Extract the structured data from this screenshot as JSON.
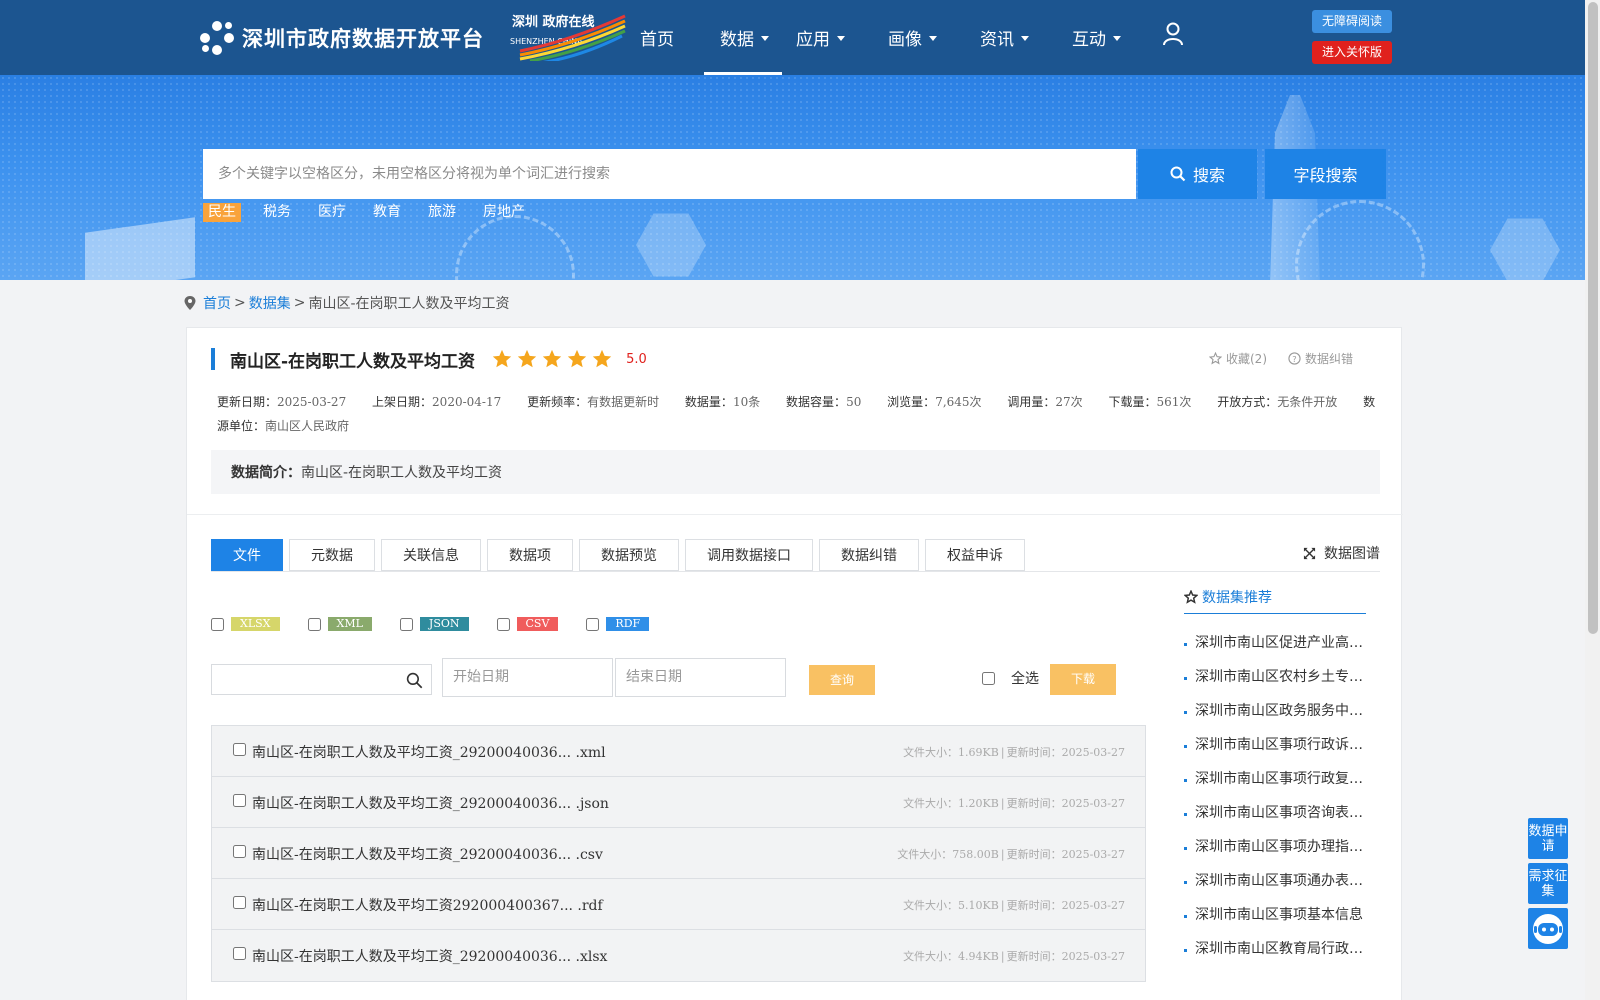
{
  "header": {
    "site_name": "深圳市政府数据开放平台",
    "city_logo_text": "深圳 政府在线",
    "city_logo_sub": "SHENZHEN CHINA",
    "nav": [
      {
        "label": "首页",
        "dropdown": false,
        "active": false
      },
      {
        "label": "数据",
        "dropdown": true,
        "active": true
      },
      {
        "label": "应用",
        "dropdown": true,
        "active": false
      },
      {
        "label": "画像",
        "dropdown": true,
        "active": false
      },
      {
        "label": "资讯",
        "dropdown": true,
        "active": false
      },
      {
        "label": "互动",
        "dropdown": true,
        "active": false
      }
    ],
    "accessible_label": "无障碍阅读",
    "care_label": "进入关怀版"
  },
  "search": {
    "placeholder": "多个关键字以空格区分，未用空格区分将视为单个词汇进行搜索",
    "search_label": "搜索",
    "field_search_label": "字段搜索",
    "hot_tags": [
      "民生",
      "税务",
      "医疗",
      "教育",
      "旅游",
      "房地产"
    ],
    "active_tag": "民生"
  },
  "breadcrumb": {
    "home": "首页",
    "datasets": "数据集",
    "sep": ">",
    "current": "南山区-在岗职工人数及平均工资"
  },
  "dataset": {
    "title": "南山区-在岗职工人数及平均工资",
    "rating_stars": 5,
    "score": "5.0",
    "favorite": "收藏(2)",
    "correction": "数据纠错",
    "meta": [
      {
        "label": "更新日期：",
        "value": "2025-03-27"
      },
      {
        "label": "上架日期：",
        "value": "2020-04-17"
      },
      {
        "label": "更新频率：",
        "value": "有数据更新时"
      },
      {
        "label": "数据量：",
        "value": "10条"
      },
      {
        "label": "数据容量：",
        "value": "50"
      },
      {
        "label": "浏览量：",
        "value": "7,645次"
      },
      {
        "label": "调用量：",
        "value": "27次"
      },
      {
        "label": "下载量：",
        "value": "561次"
      },
      {
        "label": "开放方式：",
        "value": "无条件开放"
      },
      {
        "label": "数源单位：",
        "value": "南山区人民政府"
      }
    ],
    "intro_label": "数据简介：",
    "intro_value": "南山区-在岗职工人数及平均工资"
  },
  "tabs": [
    "文件",
    "元数据",
    "关联信息",
    "数据项",
    "数据预览",
    "调用数据接口",
    "数据纠错",
    "权益申诉"
  ],
  "active_tab": "文件",
  "graph_label": "数据图谱",
  "formats": [
    {
      "label": "XLSX",
      "color": "#d6d66a"
    },
    {
      "label": "XML",
      "color": "#8aaa6c"
    },
    {
      "label": "JSON",
      "color": "#2f8c9e"
    },
    {
      "label": "CSV",
      "color": "#f05c5c"
    },
    {
      "label": "RDF",
      "color": "#2f8fe8"
    }
  ],
  "filters": {
    "start_date_placeholder": "开始日期",
    "end_date_placeholder": "结束日期",
    "query_label": "查询",
    "select_all_label": "全选",
    "download_label": "下载"
  },
  "files": [
    {
      "name": "南山区-在岗职工人数及平均工资_29200040036... .xml",
      "size": "文件大小：1.69KB",
      "updated": "更新时间：2025-03-27"
    },
    {
      "name": "南山区-在岗职工人数及平均工资_29200040036... .json",
      "size": "文件大小：1.20KB",
      "updated": "更新时间：2025-03-27"
    },
    {
      "name": "南山区-在岗职工人数及平均工资_29200040036... .csv",
      "size": "文件大小：758.00B",
      "updated": "更新时间：2025-03-27"
    },
    {
      "name": "南山区-在岗职工人数及平均工资292000400367... .rdf",
      "size": "文件大小：5.10KB",
      "updated": "更新时间：2025-03-27"
    },
    {
      "name": "南山区-在岗职工人数及平均工资_29200040036... .xlsx",
      "size": "文件大小：4.94KB",
      "updated": "更新时间：2025-03-27"
    }
  ],
  "recommend": {
    "title": "数据集推荐",
    "items": [
      "深圳市南山区促进产业高质量发展",
      "深圳市南山区农村乡土专家信息",
      "深圳市南山区政务服务中心信息",
      "深圳市南山区事项行政诉讼信息",
      "深圳市南山区事项行政复议信息",
      "深圳市南山区事项咨询表信息",
      "深圳市南山区事项办理指南信息",
      "深圳市南山区事项通办表信息",
      "深圳市南山区事项基本信息",
      "深圳市南山区教育局行政处罚"
    ]
  },
  "floating": {
    "apply_label": "数据申请",
    "demand_label": "需求征集"
  }
}
